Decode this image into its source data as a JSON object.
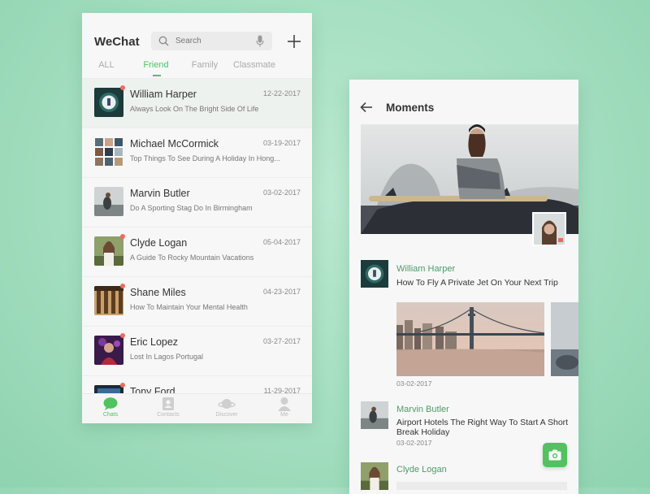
{
  "chats": {
    "app_title": "WeChat",
    "search": {
      "placeholder": "Search"
    },
    "tabs": [
      {
        "label": "ALL",
        "active": false
      },
      {
        "label": "Friend",
        "active": true
      },
      {
        "label": "Family",
        "active": false
      },
      {
        "label": "Classmate",
        "active": false
      }
    ],
    "conversations": [
      {
        "name": "William Harper",
        "message": "Always Look On The Bright Side Of Life",
        "date": "12-22-2017",
        "unread": true
      },
      {
        "name": "Michael McCormick",
        "message": "Top Things To See During A Holiday In Hong...",
        "date": "03-19-2017",
        "unread": false
      },
      {
        "name": "Marvin Butler",
        "message": "Do A Sporting Stag Do In Birmingham",
        "date": "03-02-2017",
        "unread": false
      },
      {
        "name": "Clyde Logan",
        "message": "A Guide To Rocky Mountain Vacations",
        "date": "05-04-2017",
        "unread": true
      },
      {
        "name": "Shane Miles",
        "message": "How To Maintain Your Mental Health",
        "date": "04-23-2017",
        "unread": true
      },
      {
        "name": "Eric Lopez",
        "message": "Lost In Lagos Portugal",
        "date": "03-27-2017",
        "unread": true
      },
      {
        "name": "Tony Ford",
        "message": "",
        "date": "11-29-2017",
        "unread": true
      }
    ],
    "bottom_nav": [
      {
        "label": "Chats",
        "icon": "chat-bubble-icon",
        "active": true
      },
      {
        "label": "Contacts",
        "icon": "contacts-icon",
        "active": false
      },
      {
        "label": "Discover",
        "icon": "planet-icon",
        "active": false
      },
      {
        "label": "Me",
        "icon": "person-icon",
        "active": false
      }
    ]
  },
  "moments": {
    "title": "Moments",
    "posts": [
      {
        "name": "William Harper",
        "text": "How To Fly A Private Jet On Your Next Trip",
        "date": "03-02-2017"
      },
      {
        "name": "Marvin Butler",
        "text": "Airport Hotels The Right Way To Start A Short Break Holiday",
        "date": "03-02-2017"
      },
      {
        "name": "Clyde Logan",
        "text": "",
        "date": ""
      }
    ]
  },
  "colors": {
    "accent": "#52c25f",
    "unread_dot": "#f06a62",
    "moment_name": "#4f9a6a",
    "background": "#a3dec0"
  }
}
